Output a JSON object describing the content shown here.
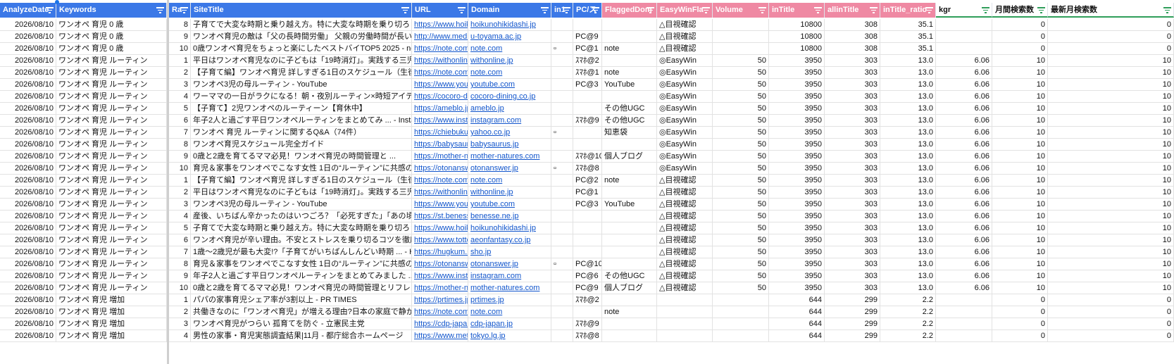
{
  "headers": [
    {
      "label": "AnalyzeDate",
      "style": "blue"
    },
    {
      "label": "Keywords",
      "style": "blue"
    },
    {
      "label": "Ra",
      "style": "blue"
    },
    {
      "label": "SiteTitle",
      "style": "blue"
    },
    {
      "label": "URL",
      "style": "blue"
    },
    {
      "label": "Domain",
      "style": "blue"
    },
    {
      "label": "in1",
      "style": "blue"
    },
    {
      "label": "PC/ス",
      "style": "blue"
    },
    {
      "label": "FlaggedDom",
      "style": "pink"
    },
    {
      "label": "EasyWinFla",
      "style": "pink"
    },
    {
      "label": "Volume",
      "style": "pink"
    },
    {
      "label": "inTitle",
      "style": "pink"
    },
    {
      "label": "allinTitle",
      "style": "pink"
    },
    {
      "label": "inTitle_ratio",
      "style": "pink"
    },
    {
      "label": "kgr",
      "style": "white"
    },
    {
      "label": "月間検索数",
      "style": "white"
    },
    {
      "label": "最新月検索数",
      "style": "white"
    }
  ],
  "rows": [
    [
      "2026/08/10",
      "ワンオペ 育児 0 歳",
      "8",
      "子育てで大変な時期と乗り越え方。特に大変な時期を乗り切ろう！",
      "https://www.hoikunohikidashi.jp",
      "hoikunohikidashi.jp",
      "",
      "",
      "",
      "△目視確認",
      "",
      "10800",
      "308",
      "35.1",
      "",
      "0",
      "0"
    ],
    [
      "2026/08/10",
      "ワンオペ 育児 0 歳",
      "9",
      "ワンオペ育児の敵は「父の長時間労働」 父親の労働時間が長いほど",
      "http://www.med.u-toyama.ac.jp",
      "u-toyama.ac.jp",
      "",
      "PC@9",
      "",
      "△目視確認",
      "",
      "10800",
      "308",
      "35.1",
      "",
      "0",
      "0"
    ],
    [
      "2026/08/10",
      "ワンオペ 育児 0 歳",
      "10",
      "0歳ワンオペ育児をちょっと楽にしたベストバイTOP5 2025 - note",
      "https://note.com",
      "note.com",
      "▫",
      "PC@1",
      "note",
      "△目視確認",
      "",
      "10800",
      "308",
      "35.1",
      "",
      "0",
      "0"
    ],
    [
      "2026/08/10",
      "ワンオペ 育児 ルーティン",
      "1",
      "平日はワンオペ育児なのに子どもは「19時消灯」。実践する三児の",
      "https://withonline.jp",
      "withonline.jp",
      "",
      "ｽﾏﾎ@2",
      "",
      "◎EasyWin",
      "50",
      "3950",
      "303",
      "13.0",
      "6.06",
      "10",
      "10"
    ],
    [
      "2026/08/10",
      "ワンオペ 育児 ルーティン",
      "2",
      "【子育て編】ワンオペ育児 詳しすぎる1日のスケジュール（生後10",
      "https://note.com",
      "note.com",
      "",
      "ｽﾏﾎ@1",
      "note",
      "◎EasyWin",
      "50",
      "3950",
      "303",
      "13.0",
      "6.06",
      "10",
      "10"
    ],
    [
      "2026/08/10",
      "ワンオペ 育児 ルーティン",
      "3",
      "ワンオペ3児の母ルーティン - YouTube",
      "https://www.youtube.com",
      "youtube.com",
      "",
      "PC@3",
      "YouTube",
      "◎EasyWin",
      "50",
      "3950",
      "303",
      "13.0",
      "6.06",
      "10",
      "10"
    ],
    [
      "2026/08/10",
      "ワンオペ 育児 ルーティン",
      "4",
      "ワーママの一日がラクになる！朝・夜別ルーティン×時短アイテム",
      "https://cocoro-dining.co.jp",
      "cocoro-dining.co.jp",
      "",
      "",
      "",
      "◎EasyWin",
      "50",
      "3950",
      "303",
      "13.0",
      "6.06",
      "10",
      "10"
    ],
    [
      "2026/08/10",
      "ワンオペ 育児 ルーティン",
      "5",
      "【子育て】2児ワンオペのルーティーン【育休中】",
      "https://ameblo.jp",
      "ameblo.jp",
      "",
      "",
      "その他UGC",
      "◎EasyWin",
      "50",
      "3950",
      "303",
      "13.0",
      "6.06",
      "10",
      "10"
    ],
    [
      "2026/08/10",
      "ワンオペ 育児 ルーティン",
      "6",
      "年子2人と過ごす平日ワンオペルーティンをまとめてみ ... - Instagra",
      "https://www.instagram.com",
      "instagram.com",
      "",
      "ｽﾏﾎ@9",
      "その他UGC",
      "◎EasyWin",
      "50",
      "3950",
      "303",
      "13.0",
      "6.06",
      "10",
      "10"
    ],
    [
      "2026/08/10",
      "ワンオペ 育児 ルーティン",
      "7",
      "ワンオペ 育児 ルーティンに関するQ&A（74件）",
      "https://chiebukuro.yahoo.co.jp",
      "yahoo.co.jp",
      "▫",
      "",
      "知恵袋",
      "◎EasyWin",
      "50",
      "3950",
      "303",
      "13.0",
      "6.06",
      "10",
      "10"
    ],
    [
      "2026/08/10",
      "ワンオペ 育児 ルーティン",
      "8",
      "ワンオペ育児スケジュール完全ガイド",
      "https://babysaurus.jp",
      "babysaurus.jp",
      "",
      "",
      "",
      "◎EasyWin",
      "50",
      "3950",
      "303",
      "13.0",
      "6.06",
      "10",
      "10"
    ],
    [
      "2026/08/10",
      "ワンオペ 育児 ルーティン",
      "9",
      "0歳と2歳を育てるママ必見！ワンオペ育児の時間管理と ...",
      "https://mother-natures.com",
      "mother-natures.com",
      "",
      "ｽﾏﾎ@10",
      "個人ブログ",
      "◎EasyWin",
      "50",
      "3950",
      "303",
      "13.0",
      "6.06",
      "10",
      "10"
    ],
    [
      "2026/08/10",
      "ワンオペ 育児 ルーティン",
      "10",
      "育児＆家事をワンオペでこなす女性 1日の“ルーティン”に共感の声",
      "https://otonanswer.jp",
      "otonanswer.jp",
      "▫",
      "ｽﾏﾎ@8",
      "",
      "◎EasyWin",
      "50",
      "3950",
      "303",
      "13.0",
      "6.06",
      "10",
      "10"
    ],
    [
      "2026/08/10",
      "ワンオペ 育児 ルーティン",
      "1",
      "【子育て編】ワンオペ育児 詳しすぎる1日のスケジュール（生後10",
      "https://note.com",
      "note.com",
      "",
      "PC@2",
      "note",
      "△目視確認",
      "50",
      "3950",
      "303",
      "13.0",
      "6.06",
      "10",
      "10"
    ],
    [
      "2026/08/10",
      "ワンオペ 育児 ルーティン",
      "2",
      "平日はワンオペ育児なのに子どもは「19時消灯」。実践する三児の",
      "https://withonline.jp",
      "withonline.jp",
      "",
      "PC@1",
      "",
      "△目視確認",
      "50",
      "3950",
      "303",
      "13.0",
      "6.06",
      "10",
      "10"
    ],
    [
      "2026/08/10",
      "ワンオペ 育児 ルーティン",
      "3",
      "ワンオペ3児の母ルーティン - YouTube",
      "https://www.youtube.com",
      "youtube.com",
      "",
      "PC@3",
      "YouTube",
      "△目視確認",
      "50",
      "3950",
      "303",
      "13.0",
      "6.06",
      "10",
      "10"
    ],
    [
      "2026/08/10",
      "ワンオペ 育児 ルーティン",
      "4",
      "産後、いちばん辛かったのはいつごろ？「必死すぎた」「あの頃の",
      "https://st.benesse.ne.jp",
      "benesse.ne.jp",
      "",
      "",
      "",
      "△目視確認",
      "50",
      "3950",
      "303",
      "13.0",
      "6.06",
      "10",
      "10"
    ],
    [
      "2026/08/10",
      "ワンオペ 育児 ルーティン",
      "5",
      "子育てで大変な時期と乗り越え方。特に大変な時期を乗り切ろう！",
      "https://www.hoikunohikidashi.jp",
      "hoikunohikidashi.jp",
      "",
      "",
      "",
      "△目視確認",
      "50",
      "3950",
      "303",
      "13.0",
      "6.06",
      "10",
      "10"
    ],
    [
      "2026/08/10",
      "ワンオペ 育児 ルーティン",
      "6",
      "ワンオペ育児が辛い理由。不安とストレスを乗り切るコツを徹底解",
      "https://www.tottoko.aeonfantasy.co.jp",
      "aeonfantasy.co.jp",
      "",
      "",
      "",
      "△目視確認",
      "50",
      "3950",
      "303",
      "13.0",
      "6.06",
      "10",
      "10"
    ],
    [
      "2026/08/10",
      "ワンオペ 育児 ルーティン",
      "7",
      "1歳〜2歳児が最も大変!?「子育てがいちばんしんどい時期 ... - Hug",
      "https://hugkum.sho.jp",
      "sho.jp",
      "",
      "",
      "",
      "△目視確認",
      "50",
      "3950",
      "303",
      "13.0",
      "6.06",
      "10",
      "10"
    ],
    [
      "2026/08/10",
      "ワンオペ 育児 ルーティン",
      "8",
      "育児＆家事をワンオペでこなす女性 1日の“ルーティン”に共感の声",
      "https://otonanswer.jp",
      "otonanswer.jp",
      "▫",
      "PC@10",
      "",
      "△目視確認",
      "50",
      "3950",
      "303",
      "13.0",
      "6.06",
      "10",
      "10"
    ],
    [
      "2026/08/10",
      "ワンオペ 育児 ルーティン",
      "9",
      "年子2人と過ごす平日ワンオペルーティンをまとめてみました ...",
      "https://www.instagram.com",
      "instagram.com",
      "",
      "PC@6",
      "その他UGC",
      "△目視確認",
      "50",
      "3950",
      "303",
      "13.0",
      "6.06",
      "10",
      "10"
    ],
    [
      "2026/08/10",
      "ワンオペ 育児 ルーティン",
      "10",
      "0歳と2歳を育てるママ必見！ワンオペ育児の時間管理とリフレッシ",
      "https://mother-natures.com",
      "mother-natures.com",
      "",
      "PC@9",
      "個人ブログ",
      "△目視確認",
      "50",
      "3950",
      "303",
      "13.0",
      "6.06",
      "10",
      "10"
    ],
    [
      "2026/08/10",
      "ワンオペ 育児 増加",
      "1",
      "パパの家事育児シェア率が3割以上 - PR TIMES",
      "https://prtimes.jp",
      "prtimes.jp",
      "",
      "ｽﾏﾎ@2",
      "",
      "",
      "",
      "644",
      "299",
      "2.2",
      "",
      "0",
      "0"
    ],
    [
      "2026/08/10",
      "ワンオペ 育児 増加",
      "2",
      "共働きなのに「ワンオペ育児」が増える理由?日本の家庭で静かに",
      "https://note.com",
      "note.com",
      "",
      "",
      "note",
      "",
      "",
      "644",
      "299",
      "2.2",
      "",
      "0",
      "0"
    ],
    [
      "2026/08/10",
      "ワンオペ 育児 増加",
      "3",
      "ワンオペ育児がつらい 孤育てを防ぐ - 立憲民主党",
      "https://cdp-japan.jp",
      "cdp-japan.jp",
      "",
      "ｽﾏﾎ@9",
      "",
      "",
      "",
      "644",
      "299",
      "2.2",
      "",
      "0",
      "0"
    ],
    [
      "2026/08/10",
      "ワンオペ 育児 増加",
      "4",
      "男性の家事・育児実態調査結果|11月 - 都庁総合ホームページ",
      "https://www.metro.tokyo.lg.jp",
      "tokyo.lg.jp",
      "",
      "ｽﾏﾎ@8",
      "",
      "",
      "",
      "644",
      "299",
      "2.2",
      "",
      "0",
      "0"
    ]
  ]
}
